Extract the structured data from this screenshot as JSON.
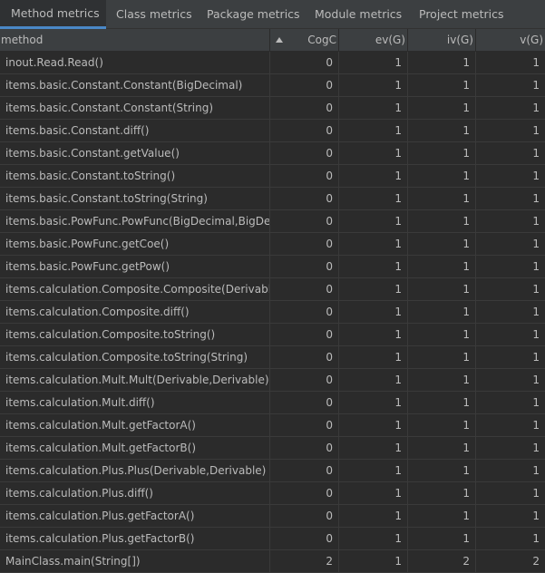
{
  "tabs": [
    {
      "label": "Method metrics",
      "active": true
    },
    {
      "label": "Class metrics",
      "active": false
    },
    {
      "label": "Package metrics",
      "active": false
    },
    {
      "label": "Module metrics",
      "active": false
    },
    {
      "label": "Project metrics",
      "active": false
    }
  ],
  "table": {
    "columns": [
      "method",
      "CogC",
      "ev(G)",
      "iv(G)",
      "v(G)"
    ],
    "sort": {
      "column": "method",
      "direction": "ascending",
      "icon": "sort-ascending-icon"
    },
    "rows": [
      {
        "method": "inout.Read.Read()",
        "CogC": "0",
        "ev(G)": "1",
        "iv(G)": "1",
        "v(G)": "1"
      },
      {
        "method": "items.basic.Constant.Constant(BigDecimal)",
        "CogC": "0",
        "ev(G)": "1",
        "iv(G)": "1",
        "v(G)": "1"
      },
      {
        "method": "items.basic.Constant.Constant(String)",
        "CogC": "0",
        "ev(G)": "1",
        "iv(G)": "1",
        "v(G)": "1"
      },
      {
        "method": "items.basic.Constant.diff()",
        "CogC": "0",
        "ev(G)": "1",
        "iv(G)": "1",
        "v(G)": "1"
      },
      {
        "method": "items.basic.Constant.getValue()",
        "CogC": "0",
        "ev(G)": "1",
        "iv(G)": "1",
        "v(G)": "1"
      },
      {
        "method": "items.basic.Constant.toString()",
        "CogC": "0",
        "ev(G)": "1",
        "iv(G)": "1",
        "v(G)": "1"
      },
      {
        "method": "items.basic.Constant.toString(String)",
        "CogC": "0",
        "ev(G)": "1",
        "iv(G)": "1",
        "v(G)": "1"
      },
      {
        "method": "items.basic.PowFunc.PowFunc(BigDecimal,BigDecim",
        "CogC": "0",
        "ev(G)": "1",
        "iv(G)": "1",
        "v(G)": "1"
      },
      {
        "method": "items.basic.PowFunc.getCoe()",
        "CogC": "0",
        "ev(G)": "1",
        "iv(G)": "1",
        "v(G)": "1"
      },
      {
        "method": "items.basic.PowFunc.getPow()",
        "CogC": "0",
        "ev(G)": "1",
        "iv(G)": "1",
        "v(G)": "1"
      },
      {
        "method": "items.calculation.Composite.Composite(Derivable,I",
        "CogC": "0",
        "ev(G)": "1",
        "iv(G)": "1",
        "v(G)": "1"
      },
      {
        "method": "items.calculation.Composite.diff()",
        "CogC": "0",
        "ev(G)": "1",
        "iv(G)": "1",
        "v(G)": "1"
      },
      {
        "method": "items.calculation.Composite.toString()",
        "CogC": "0",
        "ev(G)": "1",
        "iv(G)": "1",
        "v(G)": "1"
      },
      {
        "method": "items.calculation.Composite.toString(String)",
        "CogC": "0",
        "ev(G)": "1",
        "iv(G)": "1",
        "v(G)": "1"
      },
      {
        "method": "items.calculation.Mult.Mult(Derivable,Derivable)",
        "CogC": "0",
        "ev(G)": "1",
        "iv(G)": "1",
        "v(G)": "1"
      },
      {
        "method": "items.calculation.Mult.diff()",
        "CogC": "0",
        "ev(G)": "1",
        "iv(G)": "1",
        "v(G)": "1"
      },
      {
        "method": "items.calculation.Mult.getFactorA()",
        "CogC": "0",
        "ev(G)": "1",
        "iv(G)": "1",
        "v(G)": "1"
      },
      {
        "method": "items.calculation.Mult.getFactorB()",
        "CogC": "0",
        "ev(G)": "1",
        "iv(G)": "1",
        "v(G)": "1"
      },
      {
        "method": "items.calculation.Plus.Plus(Derivable,Derivable)",
        "CogC": "0",
        "ev(G)": "1",
        "iv(G)": "1",
        "v(G)": "1"
      },
      {
        "method": "items.calculation.Plus.diff()",
        "CogC": "0",
        "ev(G)": "1",
        "iv(G)": "1",
        "v(G)": "1"
      },
      {
        "method": "items.calculation.Plus.getFactorA()",
        "CogC": "0",
        "ev(G)": "1",
        "iv(G)": "1",
        "v(G)": "1"
      },
      {
        "method": "items.calculation.Plus.getFactorB()",
        "CogC": "0",
        "ev(G)": "1",
        "iv(G)": "1",
        "v(G)": "1"
      },
      {
        "method": "MainClass.main(String[])",
        "CogC": "2",
        "ev(G)": "1",
        "iv(G)": "2",
        "v(G)": "2"
      }
    ]
  },
  "colors": {
    "background": "#2b2b2b",
    "header_background": "#3c3f41",
    "text": "#bbbbbb",
    "active_tab_underline": "#4a88c7"
  }
}
